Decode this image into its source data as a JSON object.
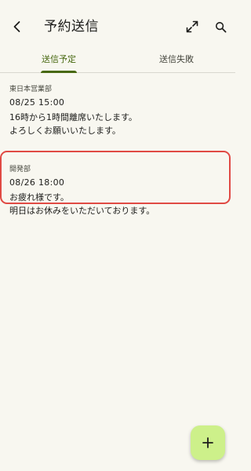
{
  "header": {
    "title": "予約送信",
    "back_icon": "arrow-left-icon",
    "expand_icon": "expand-diagonal-icon",
    "search_icon": "search-icon"
  },
  "tabs": [
    {
      "label": "送信予定",
      "selected": true
    },
    {
      "label": "送信失敗",
      "selected": false
    }
  ],
  "messages": [
    {
      "department": "東日本営業部",
      "datetime": "08/25 15:00",
      "body": "16時から1時間離席いたします。\nよろしくお願いいたします。",
      "highlighted": false
    },
    {
      "department": "開発部",
      "datetime": "08/26 18:00",
      "body": "お疲れ様です。\n明日はお休みをいただいております。",
      "highlighted": true
    }
  ],
  "fab": {
    "icon": "plus-icon"
  },
  "colors": {
    "background": "#f8f7f0",
    "accent": "#476810",
    "fab": "#cdf08a",
    "highlight_border": "#e04a44"
  }
}
